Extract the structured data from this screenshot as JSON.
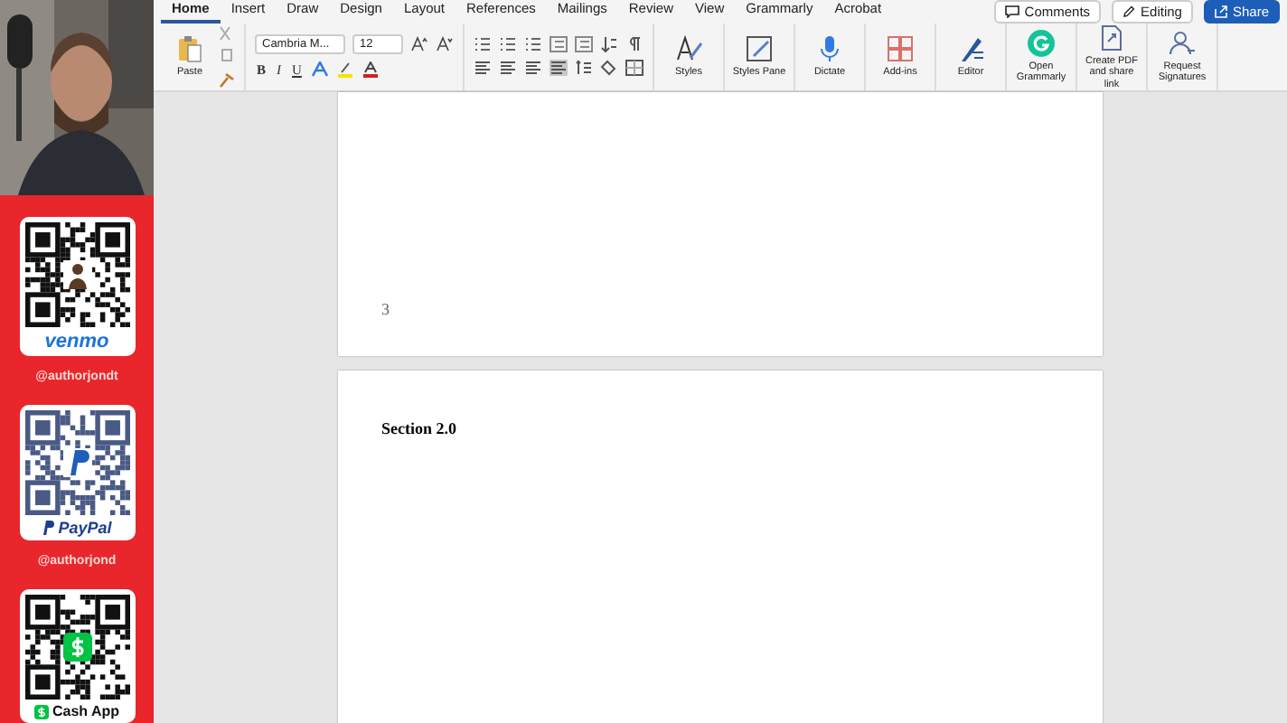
{
  "tabs": [
    {
      "label": "Home",
      "selected": true
    },
    {
      "label": "Insert",
      "selected": false
    },
    {
      "label": "Draw",
      "selected": false
    },
    {
      "label": "Design",
      "selected": false
    },
    {
      "label": "Layout",
      "selected": false
    },
    {
      "label": "References",
      "selected": false
    },
    {
      "label": "Mailings",
      "selected": false
    },
    {
      "label": "Review",
      "selected": false
    },
    {
      "label": "View",
      "selected": false
    },
    {
      "label": "Grammarly",
      "selected": false
    },
    {
      "label": "Acrobat",
      "selected": false
    }
  ],
  "top_buttons": [
    {
      "label": "Comments",
      "kind": "comments"
    },
    {
      "label": "Editing",
      "kind": "editing"
    },
    {
      "label": "Share",
      "kind": "share"
    }
  ],
  "clipboard": {
    "label": "Paste"
  },
  "font": {
    "name": "Cambria M...",
    "size": "12"
  },
  "format_glyphs": [
    "B",
    "I",
    "U"
  ],
  "ribbon_tools": [
    {
      "label": "Styles",
      "kind": "styles"
    },
    {
      "label": "Styles Pane",
      "kind": "pane"
    },
    {
      "label": "Dictate",
      "kind": "mic"
    },
    {
      "label": "Add-ins",
      "kind": "addins"
    },
    {
      "label": "Editor",
      "kind": "editor"
    },
    {
      "label": "Open Grammarly",
      "kind": "grammarly"
    },
    {
      "label": "Create PDF and share link",
      "kind": "pdf"
    },
    {
      "label": "Request Signatures",
      "kind": "sign"
    }
  ],
  "document": {
    "page_number": "3",
    "heading": "Section 2.0"
  },
  "sidebar": {
    "cards": [
      {
        "kind": "venmo",
        "label": "venmo",
        "handle": "@authorjondt"
      },
      {
        "kind": "paypal",
        "label": "PayPal",
        "handle": "@authorjond"
      },
      {
        "kind": "cashapp",
        "label": "Cash App"
      }
    ]
  }
}
